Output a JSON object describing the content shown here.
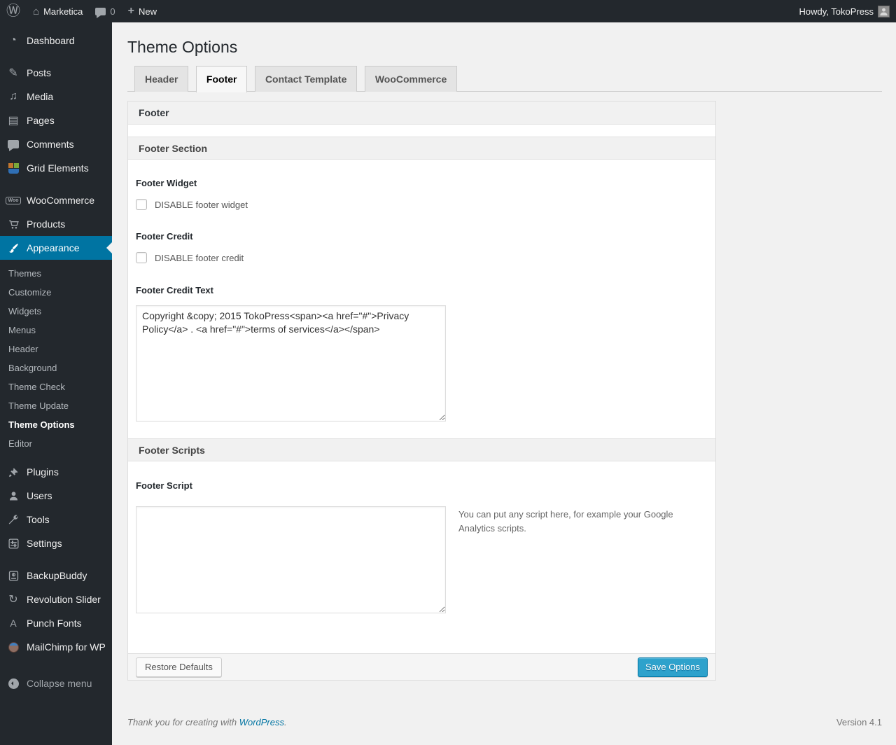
{
  "admin_bar": {
    "site_name": "Marketica",
    "comment_count": "0",
    "new_label": "New",
    "howdy": "Howdy, TokoPress"
  },
  "icons": {
    "wordpress_logo": "Ⓦ",
    "home": "⌂",
    "plus": "+",
    "dashboard": "◔",
    "pushpin": "✎",
    "media": "♫",
    "pages": "▤",
    "woo_text": "Woo",
    "refresh": "↻",
    "letter_a": "A"
  },
  "sidebar": {
    "items": [
      {
        "label": "Dashboard",
        "icon": "dashboard-icon"
      },
      {
        "label": "Posts",
        "icon": "pushpin-icon"
      },
      {
        "label": "Media",
        "icon": "media-icon"
      },
      {
        "label": "Pages",
        "icon": "pages-icon"
      },
      {
        "label": "Comments",
        "icon": "comments-icon"
      },
      {
        "label": "Grid Elements",
        "icon": "grid-icon"
      },
      {
        "label": "WooCommerce",
        "icon": "woocommerce-badge-icon"
      },
      {
        "label": "Products",
        "icon": "cart-icon"
      },
      {
        "label": "Appearance",
        "icon": "brush-icon",
        "active": true
      },
      {
        "label": "Plugins",
        "icon": "plug-icon"
      },
      {
        "label": "Users",
        "icon": "user-icon"
      },
      {
        "label": "Tools",
        "icon": "wrench-icon"
      },
      {
        "label": "Settings",
        "icon": "sliders-icon"
      },
      {
        "label": "BackupBuddy",
        "icon": "drive-icon"
      },
      {
        "label": "Revolution Slider",
        "icon": "refresh-icon"
      },
      {
        "label": "Punch Fonts",
        "icon": "letter-a-icon"
      },
      {
        "label": "MailChimp for WP",
        "icon": "monkey-icon"
      }
    ],
    "appearance_submenu": [
      "Themes",
      "Customize",
      "Widgets",
      "Menus",
      "Header",
      "Background",
      "Theme Check",
      "Theme Update",
      "Theme Options",
      "Editor"
    ],
    "current_submenu_item": "Theme Options",
    "collapse_label": "Collapse menu"
  },
  "page": {
    "title": "Theme Options",
    "tabs": [
      {
        "label": "Header"
      },
      {
        "label": "Footer",
        "active": true
      },
      {
        "label": "Contact Template"
      },
      {
        "label": "WooCommerce"
      }
    ],
    "panel": {
      "group_title": "Footer",
      "section1": {
        "title": "Footer Section",
        "footer_widget_label": "Footer Widget",
        "footer_widget_checkbox": "DISABLE footer widget",
        "footer_credit_label": "Footer Credit",
        "footer_credit_checkbox": "DISABLE footer credit",
        "footer_credit_text_label": "Footer Credit Text",
        "footer_credit_text_value": "Copyright &copy; 2015 TokoPress<span><a href=\"#\">Privacy Policy</a> . <a href=\"#\">terms of services</a></span>"
      },
      "section2": {
        "title": "Footer Scripts",
        "footer_script_label": "Footer Script",
        "footer_script_value": "",
        "footer_script_help": "You can put any script here, for example your Google Analytics scripts."
      },
      "buttons": {
        "restore": "Restore Defaults",
        "save": "Save Options"
      }
    }
  },
  "page_footer": {
    "thanks_text": "Thank you for creating with ",
    "wordpress_link": "WordPress",
    "period": ".",
    "version": "Version 4.1"
  },
  "colors": {
    "admin_bar_bg": "#23282d",
    "menu_active_bg": "#0074a2",
    "primary_button_bg": "#2ea2cc",
    "primary_button_border": "#0074a2",
    "link_blue": "#0074a2",
    "content_bg": "#f1f1f1"
  }
}
